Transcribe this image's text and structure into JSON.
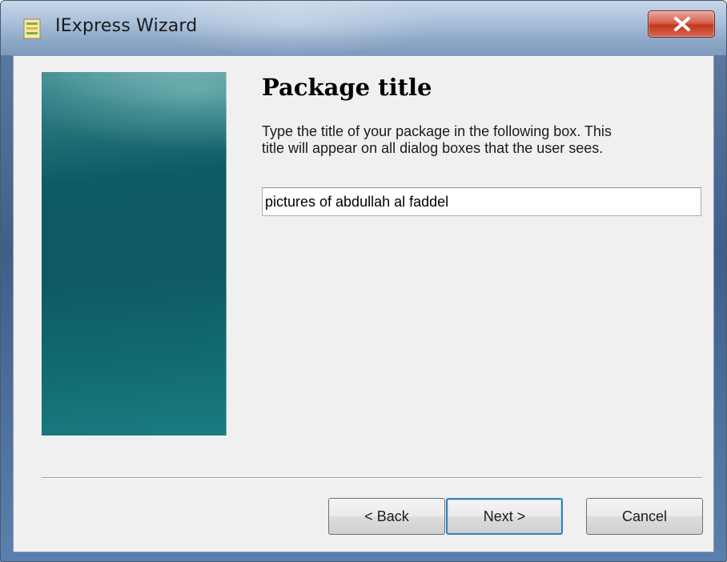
{
  "window": {
    "title": "IExpress Wizard"
  },
  "titlebar": {
    "app_icon": "iexpress-app-icon",
    "close_icon": "close-x-icon",
    "close_color": "#c2381f"
  },
  "page": {
    "heading": "Package title",
    "description_line1": "Type the title of your package in the following  box.  This",
    "description_line2": "title will appear on all dialog boxes that the user sees."
  },
  "title_field": {
    "value": "pictures of abdullah al faddel"
  },
  "side_panel": {
    "accent": "#0e5962"
  },
  "buttons": {
    "back_label": "< Back",
    "next_label": "Next >",
    "cancel_label": "Cancel"
  }
}
